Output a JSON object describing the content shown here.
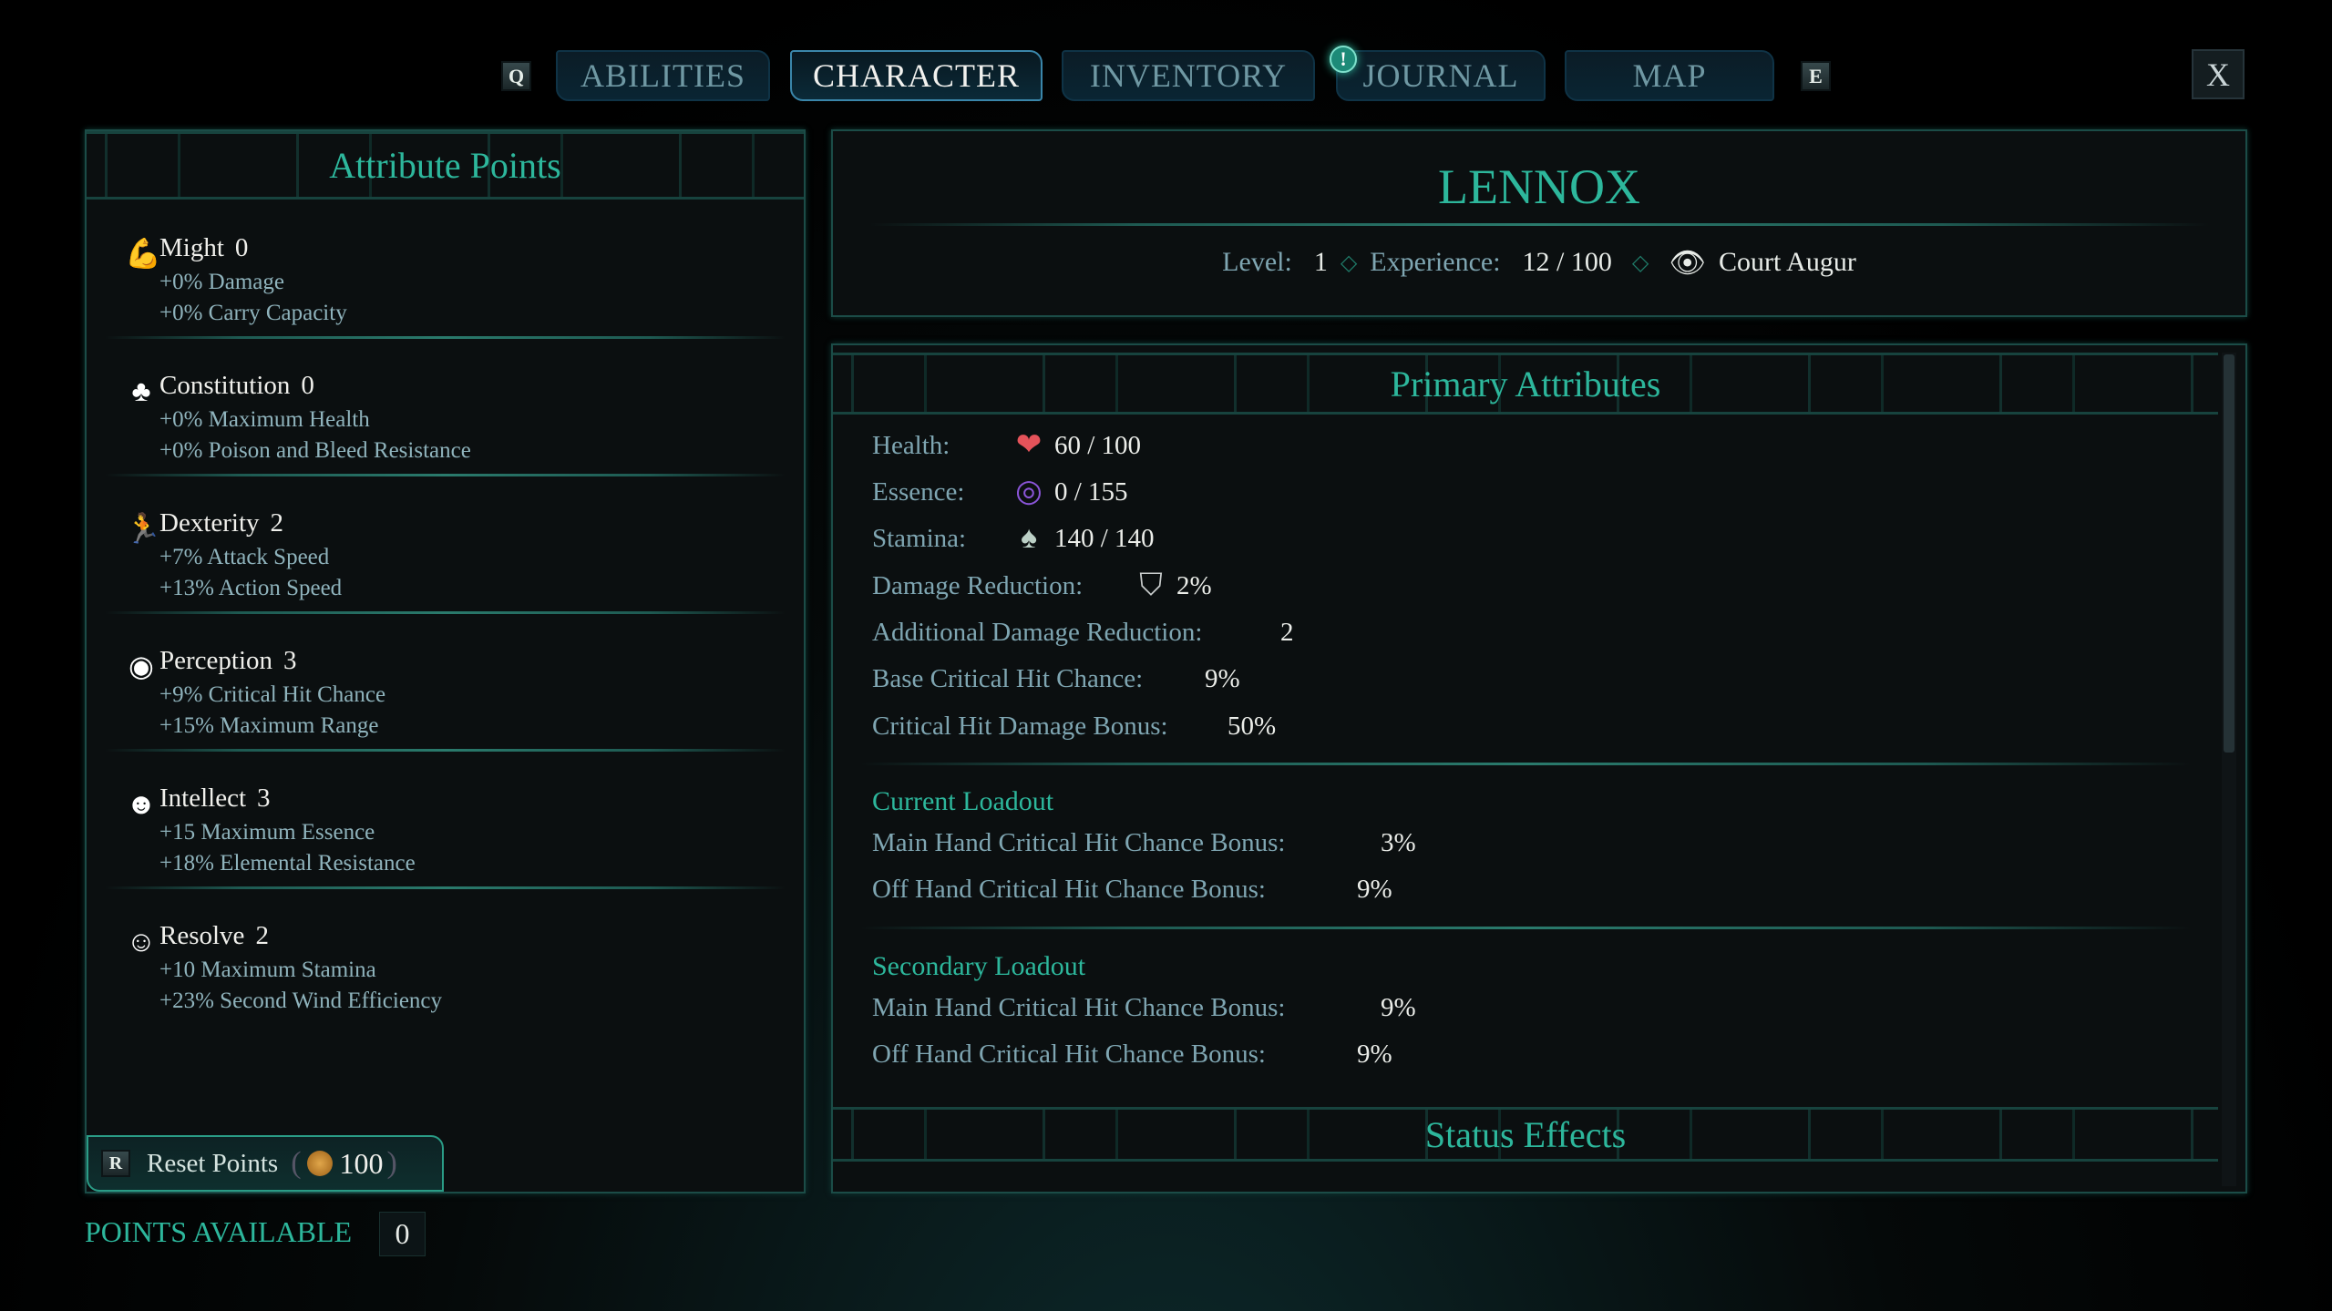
{
  "nav": {
    "prev_key": "Q",
    "next_key": "E",
    "close_label": "X",
    "tabs": [
      {
        "label": "ABILITIES"
      },
      {
        "label": "CHARACTER",
        "active": true
      },
      {
        "label": "INVENTORY"
      },
      {
        "label": "JOURNAL",
        "alert": "!"
      },
      {
        "label": "MAP"
      }
    ]
  },
  "attributes": {
    "title": "Attribute Points",
    "items": [
      {
        "name": "Might",
        "value": "0",
        "icon": "flexed-arm-icon",
        "bonuses": [
          "+0% Damage",
          "+0% Carry Capacity"
        ]
      },
      {
        "name": "Constitution",
        "value": "0",
        "icon": "heart-body-icon",
        "bonuses": [
          "+0% Maximum Health",
          "+0% Poison and Bleed Resistance"
        ]
      },
      {
        "name": "Dexterity",
        "value": "2",
        "icon": "running-figure-icon",
        "bonuses": [
          "+7% Attack Speed",
          "+13% Action Speed"
        ]
      },
      {
        "name": "Perception",
        "value": "3",
        "icon": "eye-icon",
        "bonuses": [
          "+9% Critical Hit Chance",
          "+15% Maximum Range"
        ]
      },
      {
        "name": "Intellect",
        "value": "3",
        "icon": "brain-head-icon",
        "bonuses": [
          "+15 Maximum Essence",
          "+18% Elemental Resistance"
        ]
      },
      {
        "name": "Resolve",
        "value": "2",
        "icon": "resolve-head-icon",
        "bonuses": [
          "+10 Maximum Stamina",
          "+23% Second Wind Efficiency"
        ]
      }
    ],
    "reset": {
      "key": "R",
      "label": "Reset Points",
      "cost": "100",
      "icon": "coin-icon"
    },
    "points_available_label": "POINTS AVAILABLE",
    "points_available": "0"
  },
  "character": {
    "name": "LENNOX",
    "level_label": "Level:",
    "level": "1",
    "xp_label": "Experience:",
    "xp": "12 / 100",
    "class": "Court Augur"
  },
  "primary": {
    "title": "Primary Attributes",
    "health_label": "Health:",
    "health": "60 / 100",
    "essence_label": "Essence:",
    "essence": "0 / 155",
    "stamina_label": "Stamina:",
    "stamina": "140 / 140",
    "dr_label": "Damage Reduction:",
    "dr": "2%",
    "adr_label": "Additional Damage Reduction:",
    "adr": "2",
    "bcc_label": "Base Critical Hit Chance:",
    "bcc": "9%",
    "chd_label": "Critical Hit Damage Bonus:",
    "chd": "50%",
    "current": {
      "title": "Current Loadout",
      "main_label": "Main Hand Critical Hit Chance Bonus:",
      "main": "3%",
      "off_label": "Off Hand Critical Hit Chance Bonus:",
      "off": "9%"
    },
    "secondary": {
      "title": "Secondary Loadout",
      "main_label": "Main Hand Critical Hit Chance Bonus:",
      "main": "9%",
      "off_label": "Off Hand Critical Hit Chance Bonus:",
      "off": "9%"
    },
    "status_title": "Status Effects"
  },
  "colors": {
    "accent": "#2db79c",
    "label": "#7fa6b2",
    "health": "#e5535a",
    "essence": "#8a55d8",
    "coin": "#c98a2a"
  }
}
